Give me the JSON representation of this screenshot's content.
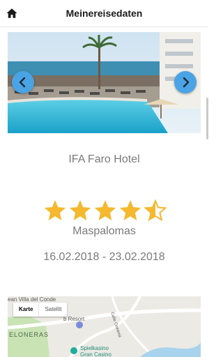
{
  "header": {
    "title": "Meinereisedaten"
  },
  "hotel": {
    "name": "IFA Faro Hotel",
    "rating": 4.5,
    "rating_max": 5,
    "location": "Maspalomas",
    "dates": "16.02.2018 - 23.02.2018"
  },
  "map": {
    "type_options": [
      "Karte",
      "Satellit"
    ],
    "selected_type": "Karte",
    "labels": {
      "area1": "ean Villa del Conde",
      "area2": "ELONERAS",
      "resort": "b Resort",
      "street": "Calle Oceania",
      "casino_line1": "Spielkasino",
      "casino_line2": "Gran Casino"
    }
  },
  "colors": {
    "accent": "#4aa3e4",
    "star": "#f5b82e",
    "text_muted": "#7a7a7a"
  },
  "icons": {
    "home": "home-icon",
    "prev": "chevron-left-icon",
    "next": "chevron-right-icon",
    "star": "star-icon"
  }
}
